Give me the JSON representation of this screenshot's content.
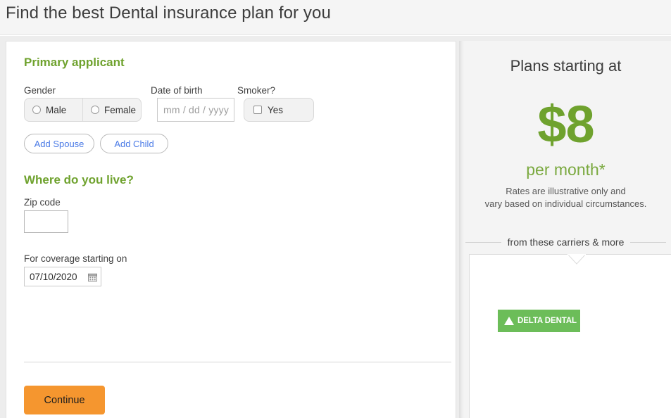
{
  "header": {
    "title": "Find the best Dental insurance plan for you"
  },
  "form": {
    "primary_section": {
      "heading": "Primary applicant",
      "gender": {
        "label": "Gender",
        "options": [
          "Male",
          "Female"
        ],
        "selected": ""
      },
      "date_of_birth": {
        "label": "Date of birth",
        "placeholder": "mm / dd / yyyy",
        "value": ""
      },
      "smoker": {
        "label": "Smoker?",
        "option": "Yes",
        "checked": false
      }
    },
    "add_buttons": {
      "spouse": "Add Spouse",
      "child": "Add Child"
    },
    "where_section": {
      "heading": "Where do you live?",
      "zip": {
        "label": "Zip code",
        "value": "",
        "placeholder": ""
      },
      "coverage": {
        "label": "For coverage starting on",
        "value": "07/10/2020",
        "icon": "calendar-icon"
      }
    },
    "submit": {
      "label": "Continue",
      "color": "#f5962f"
    }
  },
  "sidebar": {
    "title": "Plans starting at",
    "price": "$8",
    "period": "per month*",
    "disclaimer": "Rates are illustrative only and vary based on individual circumstances.",
    "disclaimer_line1": "Rates are illustrative only and",
    "disclaimer_line2": "vary based on individual circumstances.",
    "carriers_label": "from these carriers & more",
    "carriers": [
      {
        "name": "DELTA DENTAL",
        "color": "#6cbd59",
        "icon": "delta-triangle-icon"
      }
    ]
  },
  "theme": {
    "green": "#6fa22e",
    "orange": "#f5962f",
    "link_blue": "#4a7ae6"
  }
}
